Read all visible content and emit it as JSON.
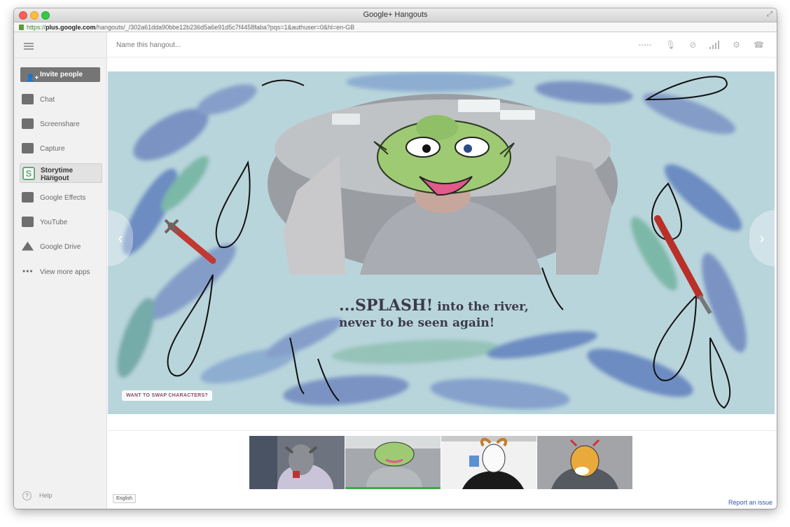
{
  "window": {
    "title": "Google+ Hangouts",
    "url_scheme": "https://",
    "url_host": "plus.google.com",
    "url_path": "/hangouts/_/302a61dda90bbe12b236d5a6e91d5c7f4458faba?pqs=1&authuser=0&hl=en-GB"
  },
  "sidebar": {
    "invite_label": "Invite people",
    "items": [
      {
        "label": "Chat",
        "icon": "chat-icon"
      },
      {
        "label": "Screenshare",
        "icon": "screenshare-icon"
      },
      {
        "label": "Capture",
        "icon": "camera-icon"
      },
      {
        "label": "Storytime Hangout",
        "sub": "Kenzo",
        "icon": "storytime-icon",
        "active": true
      },
      {
        "label": "Google Effects",
        "icon": "effects-icon"
      },
      {
        "label": "YouTube",
        "icon": "youtube-icon"
      },
      {
        "label": "Google Drive",
        "icon": "drive-icon"
      },
      {
        "label": "View more apps",
        "icon": "more-dots-icon"
      }
    ],
    "help_label": "Help"
  },
  "topbar": {
    "name_placeholder": "Name this hangout..."
  },
  "stage": {
    "caption_line1_big": "...SPLASH!",
    "caption_line1_rest": " into the river,",
    "caption_line2": "never to be seen again!",
    "swap_label": "WANT TO SWAP CHARACTERS?"
  },
  "footer": {
    "language": "English",
    "report_label": "Report an issue"
  },
  "colors": {
    "selected_thumb": "#3aab4a",
    "link": "#2a5cb0"
  }
}
